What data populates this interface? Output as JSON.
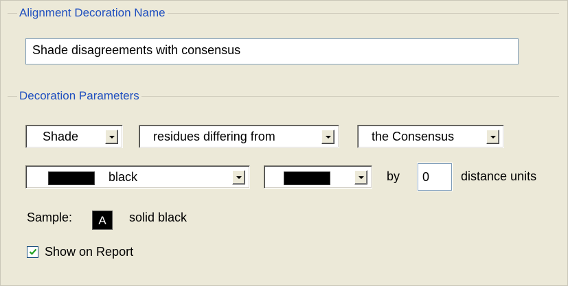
{
  "name_group": {
    "title": "Alignment Decoration Name",
    "name_value": "Shade disagreements with consensus"
  },
  "params_group": {
    "title": "Decoration Parameters",
    "action_select": "Shade",
    "target_select": "residues differing from",
    "reference_select": "the Consensus",
    "color_select": "black",
    "color_select_swatch": "#000000",
    "second_color_swatch": "#000000",
    "by_label": "by",
    "distance_value": "0",
    "distance_units_label": "distance units",
    "sample_label": "Sample:",
    "sample_letter": "A",
    "sample_description": "solid black",
    "show_on_report_label": "Show on Report",
    "show_on_report_checked": true
  },
  "colors": {
    "group_title": "#1f4fbf",
    "background": "#ece9d8",
    "check": "#21a121"
  }
}
